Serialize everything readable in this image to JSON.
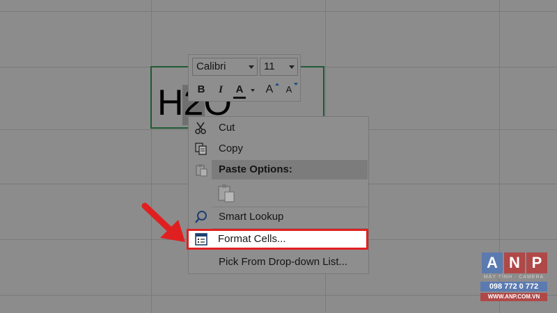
{
  "cell": {
    "text": "H2O"
  },
  "mini_toolbar": {
    "font_name": "Calibri",
    "font_size": "11",
    "bold": "B",
    "italic": "I",
    "font_color": "A",
    "grow_font": "A",
    "shrink_font": "A"
  },
  "context_menu": {
    "cut": "Cut",
    "copy": "Copy",
    "paste_options": "Paste Options:",
    "smart_lookup": "Smart Lookup",
    "format_cells": "Format Cells...",
    "pick_from_list": "Pick From Drop-down List..."
  },
  "watermark": {
    "letters": [
      "A",
      "N",
      "P"
    ],
    "subtitle": "MÁY TÍNH · CAMERA",
    "phone": "098 772 0 772",
    "website": "WWW.ANP.COM.VN"
  },
  "colors": {
    "highlight_border": "#e02020",
    "arrow": "#e02020",
    "cell_border": "#1e5a32"
  }
}
